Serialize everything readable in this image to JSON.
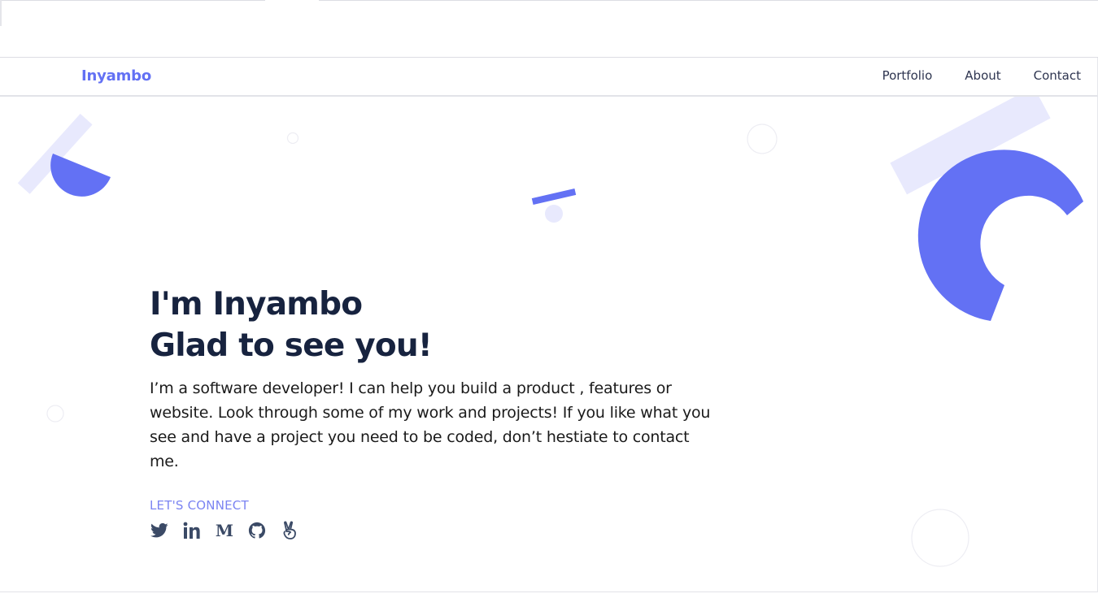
{
  "navbar": {
    "brand": "Inyambo",
    "links": [
      "Portfolio",
      "About",
      "Contact"
    ]
  },
  "hero": {
    "headline_line1": "I'm Inyambo",
    "headline_line2": "Glad to see you!",
    "intro": "I’m a software developer! I can help you build a product , features or website. Look through some of my work and projects! If you like what you see and have a project you need to be coded, don’t hestiate to contact me.",
    "connect_label": "LET'S CONNECT",
    "socials": [
      {
        "name": "twitter",
        "icon": "twitter-icon"
      },
      {
        "name": "linkedin",
        "icon": "linkedin-icon",
        "glyph": "in"
      },
      {
        "name": "medium",
        "icon": "medium-icon",
        "glyph": "M"
      },
      {
        "name": "github",
        "icon": "github-icon"
      },
      {
        "name": "angellist",
        "icon": "angellist-icon"
      }
    ]
  },
  "colors": {
    "accent": "#6371f4",
    "heading": "#17233f",
    "icon": "#3b4a66",
    "shape_light": "#e8e9fd"
  }
}
